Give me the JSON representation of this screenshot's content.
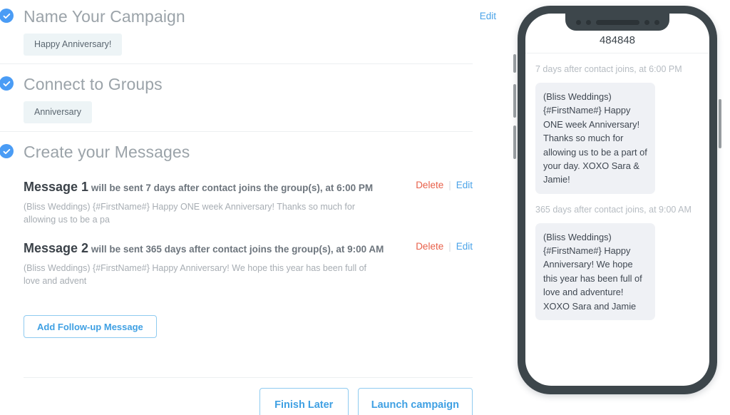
{
  "campaign_builder": {
    "sections": [
      {
        "id": "name-campaign",
        "title": "Name Your Campaign",
        "status_icon": "check-circle-icon",
        "chip": "Happy Anniversary!",
        "edit_label": "Edit"
      },
      {
        "id": "connect-groups",
        "title": "Connect to Groups",
        "status_icon": "check-circle-icon",
        "chip": "Anniversary"
      },
      {
        "id": "create-messages",
        "title": "Create your Messages",
        "status_icon": "check-circle-icon"
      }
    ],
    "messages": [
      {
        "number_label": "Message 1",
        "schedule_text": " will be sent 7 days after contact joins the group(s), at 6:00 PM",
        "preview": "(Bliss Weddings) {#FirstName#} Happy ONE week Anniversary! Thanks so much for allowing us to be a pa",
        "delete_label": "Delete",
        "separator": "|",
        "edit_label": "Edit"
      },
      {
        "number_label": "Message 2",
        "schedule_text": " will be sent 365 days after contact joins the group(s), at 9:00 AM",
        "preview": "(Bliss Weddings) {#FirstName#} Happy Anniversary! We hope this year has been full of love and advent",
        "delete_label": "Delete",
        "separator": "|",
        "edit_label": "Edit"
      }
    ],
    "add_followup_label": "Add Follow-up Message",
    "footer": {
      "finish_later_label": "Finish Later",
      "launch_label": "Launch campaign"
    }
  },
  "phone_preview": {
    "sender_number": "484848",
    "messages": [
      {
        "timestamp": "7 days after contact joins, at 6:00 PM",
        "body": "(Bliss Weddings) {#FirstName#} Happy ONE week Anniversary! Thanks so much for allowing us to be a part of your day. XOXO Sara & Jamie!"
      },
      {
        "timestamp": "365 days after contact joins, at 9:00 AM",
        "body": "(Bliss Weddings) {#FirstName#} Happy Anniversary! We hope this year has been full of love and adventure! XOXO Sara and Jamie"
      }
    ]
  },
  "colors": {
    "accent_blue": "#4aa3e8",
    "check_blue": "#4a9cf5",
    "delete_red": "#e8604a",
    "heading_gray": "#9ba3a9",
    "chip_bg": "#edf4f6",
    "bubble_bg": "#eff1f5",
    "phone_frame": "#3d464b"
  }
}
